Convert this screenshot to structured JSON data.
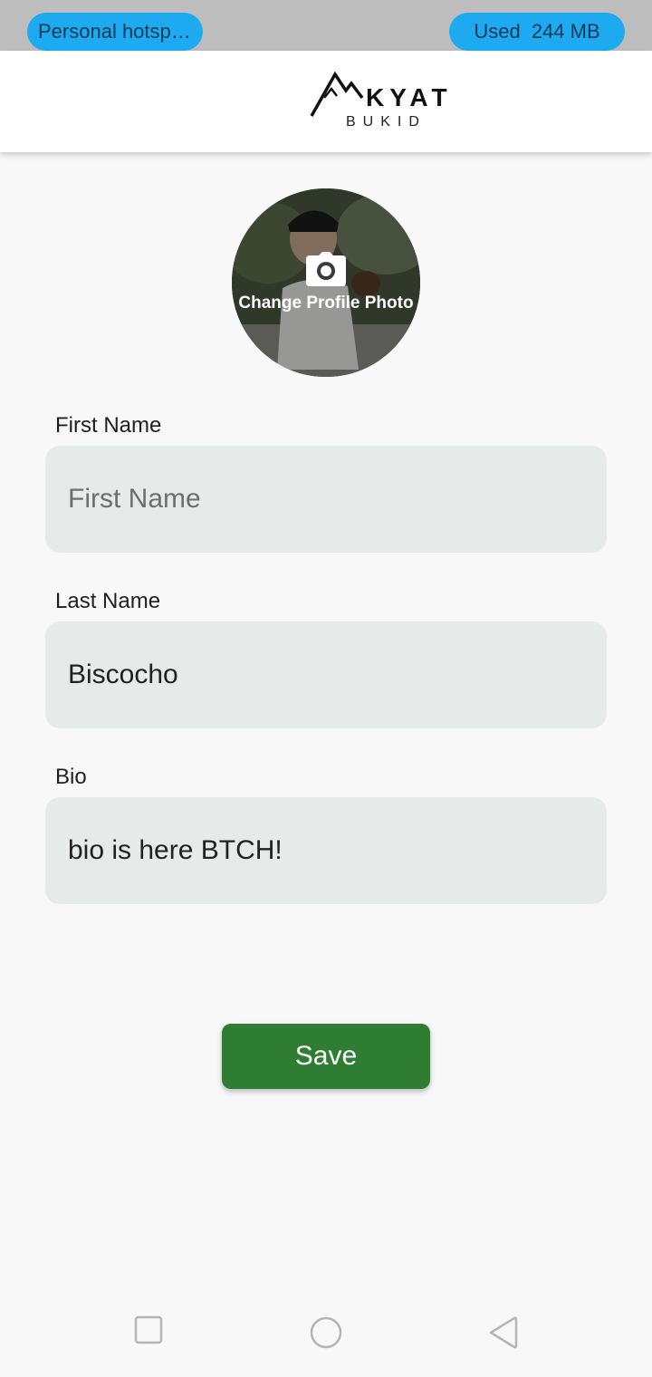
{
  "status_bar": {
    "hotspot_label": "Personal hotspot...",
    "usage_prefix": "Used",
    "usage_value": "244 MB"
  },
  "app_bar": {
    "logo_word": "KYAT",
    "logo_sub": "BUKID"
  },
  "profile": {
    "change_photo_label": "Change Profile Photo"
  },
  "form": {
    "first_name": {
      "label": "First Name",
      "value": "",
      "placeholder": "First Name"
    },
    "last_name": {
      "label": "Last Name",
      "value": "Biscocho"
    },
    "bio": {
      "label": "Bio",
      "value": "bio is here BTCH!"
    }
  },
  "actions": {
    "save_label": "Save"
  },
  "colors": {
    "status_pill": "#1eaaf1",
    "save_button": "#2e7d32",
    "field_background": "#e6ebea"
  },
  "icons": {
    "camera": "camera-icon",
    "nav_recents": "square-icon",
    "nav_home": "circle-icon",
    "nav_back": "triangle-back-icon"
  }
}
